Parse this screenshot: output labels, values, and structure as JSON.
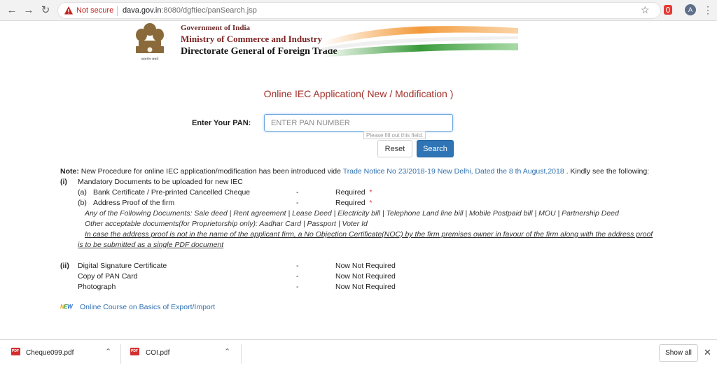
{
  "browser": {
    "security_label": "Not secure",
    "url_host": "dava.gov.in",
    "url_rest": ":8080/dgftiec/panSearch.jsp",
    "avatar_initial": "A",
    "icons": [
      "back-arrow-icon",
      "forward-arrow-icon",
      "reload-icon",
      "warning-icon",
      "star-icon",
      "extension-icon",
      "menu-icon"
    ]
  },
  "header": {
    "emblem_caption": "सत्यमेव जयते",
    "line1": "Government of India",
    "line2": "Ministry of Commerce and Industry",
    "line3": "Directorate General of Foreign Trade"
  },
  "form": {
    "title": "Online IEC Application( New / Modification )",
    "pan_label": "Enter Your PAN:",
    "pan_placeholder": "ENTER PAN NUMBER",
    "pan_value": "",
    "validation_tooltip": "Please fill out this field.",
    "reset_label": "Reset",
    "search_label": "Search"
  },
  "note": {
    "label": "Note:",
    "text_before": " New Procedure for online IEC application/modification has been introduced vide ",
    "trade_notice_link": "Trade Notice No 23/2018-19 New Delhi, Dated the 8 th August,2018",
    "text_after": " . Kindly see the following:",
    "section1": {
      "marker": "(i)",
      "heading": "Mandatory Documents to be uploaded for new IEC",
      "item_a_marker": "(a)",
      "item_a": "Bank Certificate / Pre-printed Cancelled Cheque",
      "item_a_dash": "-",
      "item_a_status": "Required",
      "item_b_marker": "(b)",
      "item_b": "Address Proof of the firm",
      "item_b_dash": "-",
      "item_b_status": "Required",
      "required_star": "*",
      "docs_line": "Any of the Following Documents: Sale deed | Rent agreement | Lease Deed | Electricity bill | Telephone Land line bill | Mobile Postpaid bill | MOU | Partnership Deed",
      "other_docs_line": "Other acceptable documents(for Proprietorship only): Aadhar Card | Passport | Voter Id",
      "noc_line1": "In case the address proof is not in the name of the applicant firm, a No Objection Certificate(NOC) by the firm premises owner in favour of the firm along with the address proof",
      "noc_line2": "is to be submitted as a single PDF document"
    },
    "section2": {
      "marker": "(ii)",
      "items": [
        {
          "label": "Digital Signature Certificate",
          "dash": "-",
          "status": "Now Not Required"
        },
        {
          "label": "Copy of PAN Card",
          "dash": "-",
          "status": "Now Not Required"
        },
        {
          "label": "Photograph",
          "dash": "-",
          "status": "Now Not Required"
        }
      ]
    },
    "new_badge": [
      "N",
      "E",
      "W"
    ],
    "course_link": "Online Course on Basics of Export/Import"
  },
  "downloads": {
    "items": [
      {
        "name": "Cheque099.pdf"
      },
      {
        "name": "COI.pdf"
      }
    ],
    "show_all_label": "Show all"
  },
  "colors": {
    "title_red": "#a0302a",
    "link_blue": "#2f6fb0",
    "search_button": "#2f74b5",
    "required_star": "#d43f3a"
  }
}
